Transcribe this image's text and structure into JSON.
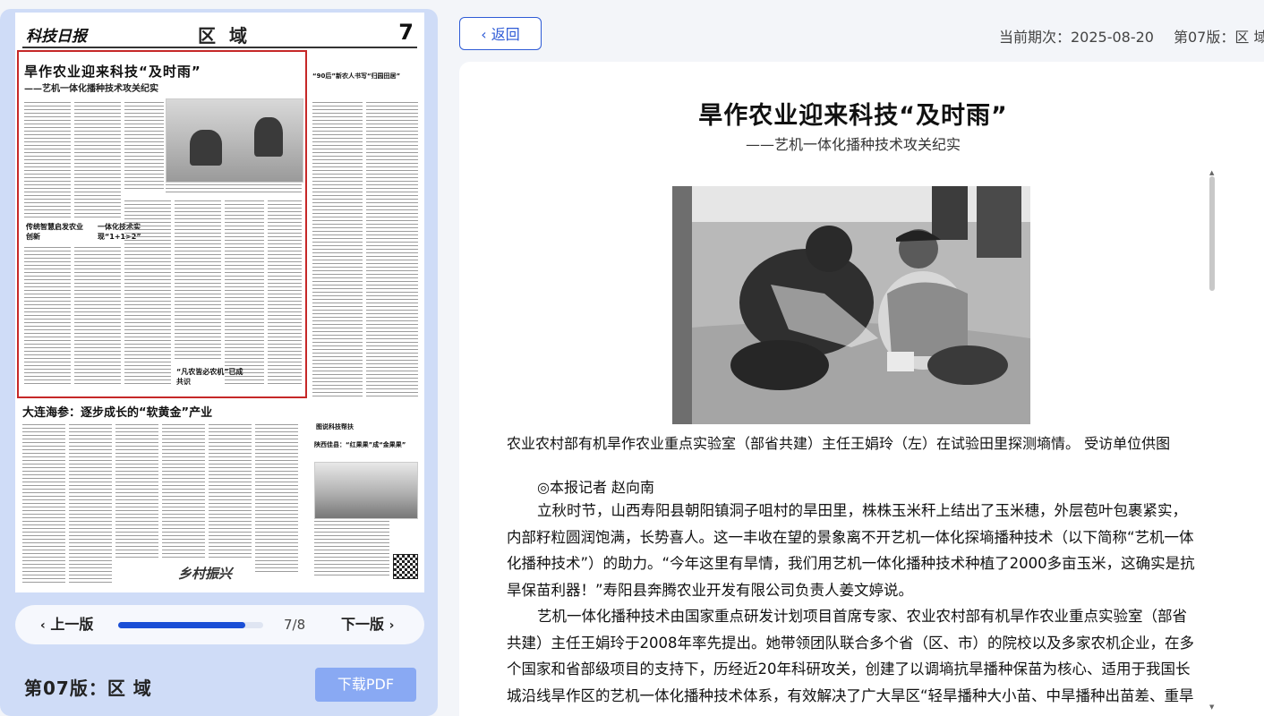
{
  "header": {
    "back_label": "返回",
    "issue_label": "当前期次：2025-08-20",
    "edition_label": "第07版：区 域"
  },
  "newspaper": {
    "masthead": "科技日报",
    "section": "区 域",
    "page_number": "7",
    "lead_title": "旱作农业迎来科技“及时雨”",
    "lead_subtitle": "——艺机一体化播种技术攻关纪实",
    "subhead_1": "传统智慧启发农业创新",
    "subhead_2": "一体化技术实现“1+1>2”",
    "subhead_3": "“凡农皆必农机”已成共识",
    "right_title": "“90后”新农人书写“归园田居”",
    "second_title": "大连海参：逐步成长的“软黄金”产业",
    "box_tag": "图说科技帮扶",
    "box_title": "陕西佳县：“红果果”成“金果果”",
    "banner_text": "乡村振兴"
  },
  "pager": {
    "prev_label": "上一版",
    "next_label": "下一版",
    "current": 7,
    "total": 8,
    "count_text": "7/8",
    "progress": 0.875
  },
  "sidebar": {
    "edition_title": "第07版：区 域",
    "download_label": "下载PDF"
  },
  "article": {
    "title": "旱作农业迎来科技“及时雨”",
    "subtitle": "——艺机一体化播种技术攻关纪实",
    "caption": "农业农村部有机旱作农业重点实验室（部省共建）主任王娟玲（左）在试验田里探测墒情。 受访单位供图",
    "byline": "◎本报记者 赵向南",
    "paragraphs": [
      "立秋时节，山西寿阳县朝阳镇洞子咀村的旱田里，株株玉米秆上结出了玉米穗，外层苞叶包裹紧实，内部籽粒圆润饱满，长势喜人。这一丰收在望的景象离不开艺机一体化探墒播种技术（以下简称“艺机一体化播种技术”）的助力。“今年这里有旱情，我们用艺机一体化播种技术种植了2000多亩玉米，这确实是抗旱保苗利器！”寿阳县奔腾农业开发有限公司负责人姜文婷说。",
      "艺机一体化播种技术由国家重点研发计划项目首席专家、农业农村部有机旱作农业重点实验室（部省共建）主任王娟玲于2008年率先提出。她带领团队联合多个省（区、市）的院校以及多家农机企业，在多个国家和省部级项目的支持下，历经近20年科研攻关，创建了以调墒抗旱播种保苗为核心、适用于我国长城沿线旱作区的艺机一体化播种技术体系，有效解决了广大旱区“轻旱播种大小苗、中旱播种出苗差、重旱"
    ]
  }
}
